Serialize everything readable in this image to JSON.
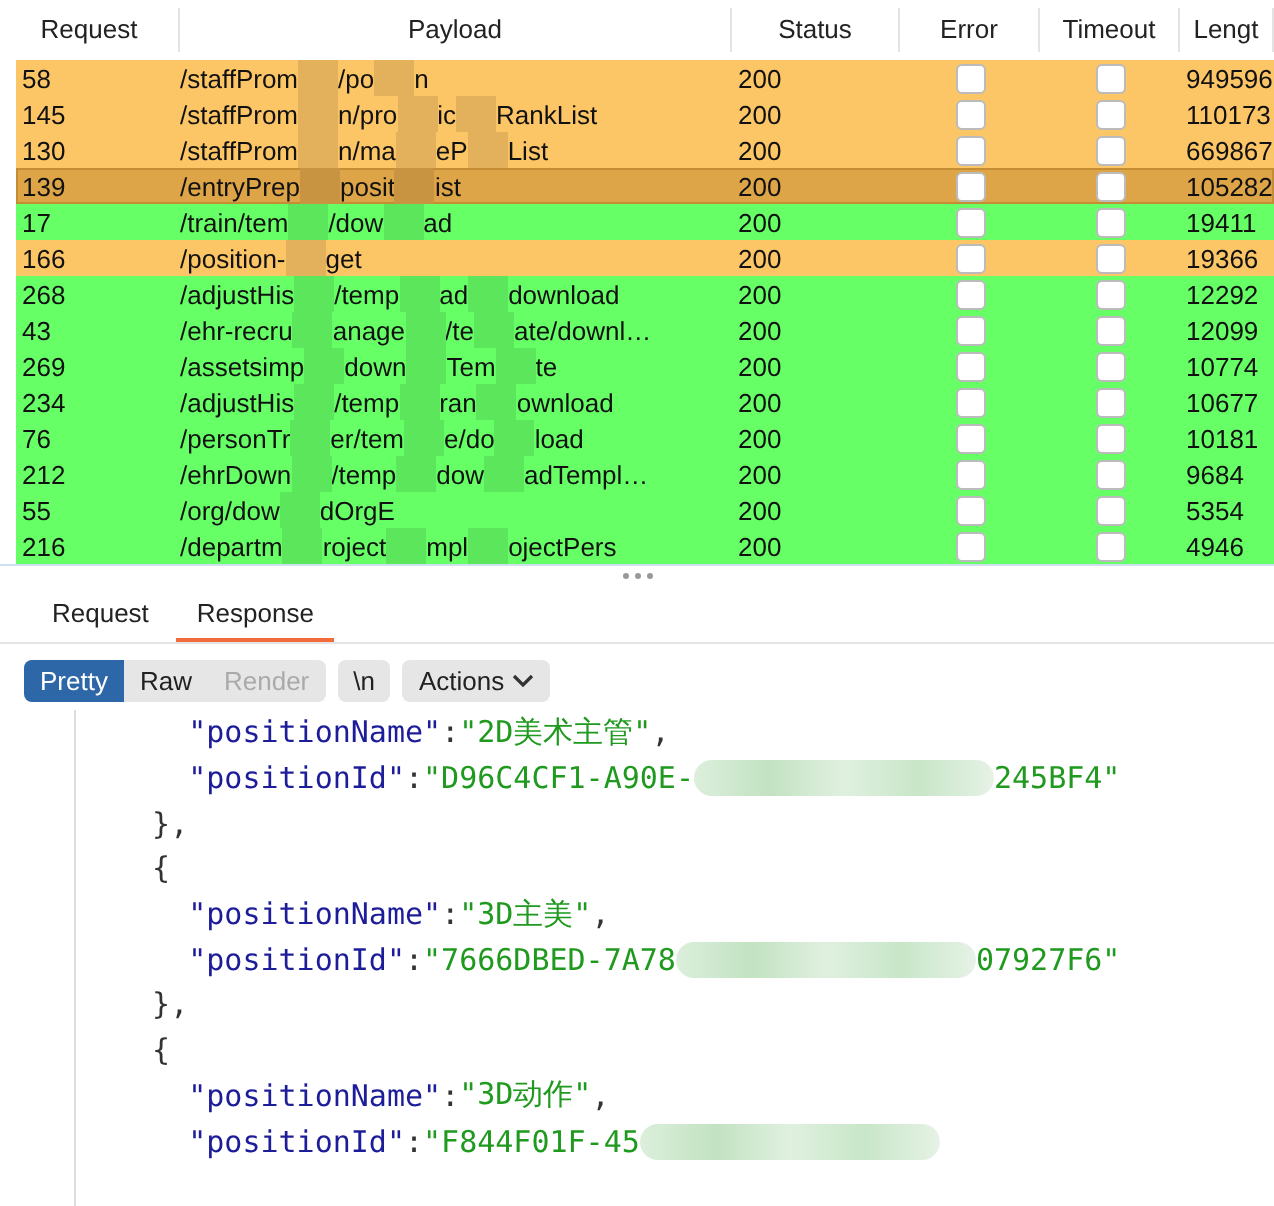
{
  "table": {
    "columns": [
      "Request",
      "Payload",
      "Status",
      "Error",
      "Timeout",
      "Lengt"
    ],
    "rows": [
      {
        "request": "58",
        "payload": [
          "/staffProm",
          "/po",
          "n"
        ],
        "status": "200",
        "error": false,
        "timeout": false,
        "length": "949596",
        "color": "#fcc566",
        "selected": false
      },
      {
        "request": "145",
        "payload": [
          "/staffProm",
          "n/pro",
          "ic",
          "RankList"
        ],
        "status": "200",
        "error": false,
        "timeout": false,
        "length": "110173",
        "color": "#fcc566",
        "selected": false
      },
      {
        "request": "130",
        "payload": [
          "/staffProm",
          "n/ma",
          "eP",
          "List"
        ],
        "status": "200",
        "error": false,
        "timeout": false,
        "length": "669867",
        "color": "#fcc566",
        "selected": false
      },
      {
        "request": "139",
        "payload": [
          "/entryPrep",
          "posit",
          "ist"
        ],
        "status": "200",
        "error": false,
        "timeout": false,
        "length": "105282",
        "color": "#dea548",
        "selected": true
      },
      {
        "request": "17",
        "payload": [
          "/train/tem",
          "/dow",
          "ad"
        ],
        "status": "200",
        "error": false,
        "timeout": false,
        "length": "19411",
        "color": "#66ff66",
        "selected": false
      },
      {
        "request": "166",
        "payload": [
          "/position-",
          "get"
        ],
        "status": "200",
        "error": false,
        "timeout": false,
        "length": "19366",
        "color": "#fcc566",
        "selected": false
      },
      {
        "request": "268",
        "payload": [
          "/adjustHis",
          "/temp",
          "ad",
          "download"
        ],
        "status": "200",
        "error": false,
        "timeout": false,
        "length": "12292",
        "color": "#66ff66",
        "selected": false
      },
      {
        "request": "43",
        "payload": [
          "/ehr-recru",
          "anage",
          "/te",
          "ate/downl…"
        ],
        "status": "200",
        "error": false,
        "timeout": false,
        "length": "12099",
        "color": "#66ff66",
        "selected": false
      },
      {
        "request": "269",
        "payload": [
          "/assetsimp",
          "down",
          "Tem",
          "te"
        ],
        "status": "200",
        "error": false,
        "timeout": false,
        "length": "10774",
        "color": "#66ff66",
        "selected": false
      },
      {
        "request": "234",
        "payload": [
          "/adjustHis",
          "/temp",
          "ran",
          "ownload"
        ],
        "status": "200",
        "error": false,
        "timeout": false,
        "length": "10677",
        "color": "#66ff66",
        "selected": false
      },
      {
        "request": "76",
        "payload": [
          "/personTr",
          "er/tem",
          "e/do",
          "load"
        ],
        "status": "200",
        "error": false,
        "timeout": false,
        "length": "10181",
        "color": "#66ff66",
        "selected": false
      },
      {
        "request": "212",
        "payload": [
          "/ehrDown",
          "/temp",
          "dow",
          "adTempl…"
        ],
        "status": "200",
        "error": false,
        "timeout": false,
        "length": "9684",
        "color": "#66ff66",
        "selected": false
      },
      {
        "request": "55",
        "payload": [
          "/org/dow",
          "dOrgE"
        ],
        "status": "200",
        "error": false,
        "timeout": false,
        "length": "5354",
        "color": "#66ff66",
        "selected": false
      },
      {
        "request": "216",
        "payload": [
          "/departm",
          "roject",
          "mpl",
          "ojectPers"
        ],
        "status": "200",
        "error": false,
        "timeout": false,
        "length": "4946",
        "color": "#66ff66",
        "selected": false
      }
    ]
  },
  "tabs": [
    {
      "label": "Request",
      "selected": false
    },
    {
      "label": "Response",
      "selected": true
    }
  ],
  "view_buttons": [
    {
      "label": "Pretty",
      "selected": true,
      "disabled": false
    },
    {
      "label": "Raw",
      "selected": false,
      "disabled": false
    },
    {
      "label": "Render",
      "selected": false,
      "disabled": true
    }
  ],
  "newline_button": "\\n",
  "actions_button": "Actions",
  "code_lines": [
    [
      {
        "kind": "key",
        "text": "    \"positionName\""
      },
      {
        "kind": "punct",
        "text": ":"
      },
      {
        "kind": "string",
        "text": "\"2D美术主管\""
      },
      {
        "kind": "punct",
        "text": ","
      }
    ],
    [
      {
        "kind": "key",
        "text": "    \"positionId\""
      },
      {
        "kind": "punct",
        "text": ":"
      },
      {
        "kind": "string",
        "text": "\"D96C4CF1-A90E-"
      },
      {
        "kind": "mosaic"
      },
      {
        "kind": "string",
        "text": "245BF4\""
      }
    ],
    [
      {
        "kind": "punct",
        "text": "  },"
      }
    ],
    [
      {
        "kind": "punct",
        "text": "  {"
      }
    ],
    [
      {
        "kind": "key",
        "text": "    \"positionName\""
      },
      {
        "kind": "punct",
        "text": ":"
      },
      {
        "kind": "string",
        "text": "\"3D主美\""
      },
      {
        "kind": "punct",
        "text": ","
      }
    ],
    [
      {
        "kind": "key",
        "text": "    \"positionId\""
      },
      {
        "kind": "punct",
        "text": ":"
      },
      {
        "kind": "string",
        "text": "\"7666DBED-7A78"
      },
      {
        "kind": "mosaic"
      },
      {
        "kind": "string",
        "text": "07927F6\""
      }
    ],
    [
      {
        "kind": "punct",
        "text": "  },"
      }
    ],
    [
      {
        "kind": "punct",
        "text": "  {"
      }
    ],
    [
      {
        "kind": "key",
        "text": "    \"positionName\""
      },
      {
        "kind": "punct",
        "text": ":"
      },
      {
        "kind": "string",
        "text": "\"3D动作\""
      },
      {
        "kind": "punct",
        "text": ","
      }
    ],
    [
      {
        "kind": "key",
        "text": "    \"positionId\""
      },
      {
        "kind": "punct",
        "text": ":"
      },
      {
        "kind": "string",
        "text": "\"F844F01F-45"
      },
      {
        "kind": "mosaic"
      }
    ]
  ]
}
